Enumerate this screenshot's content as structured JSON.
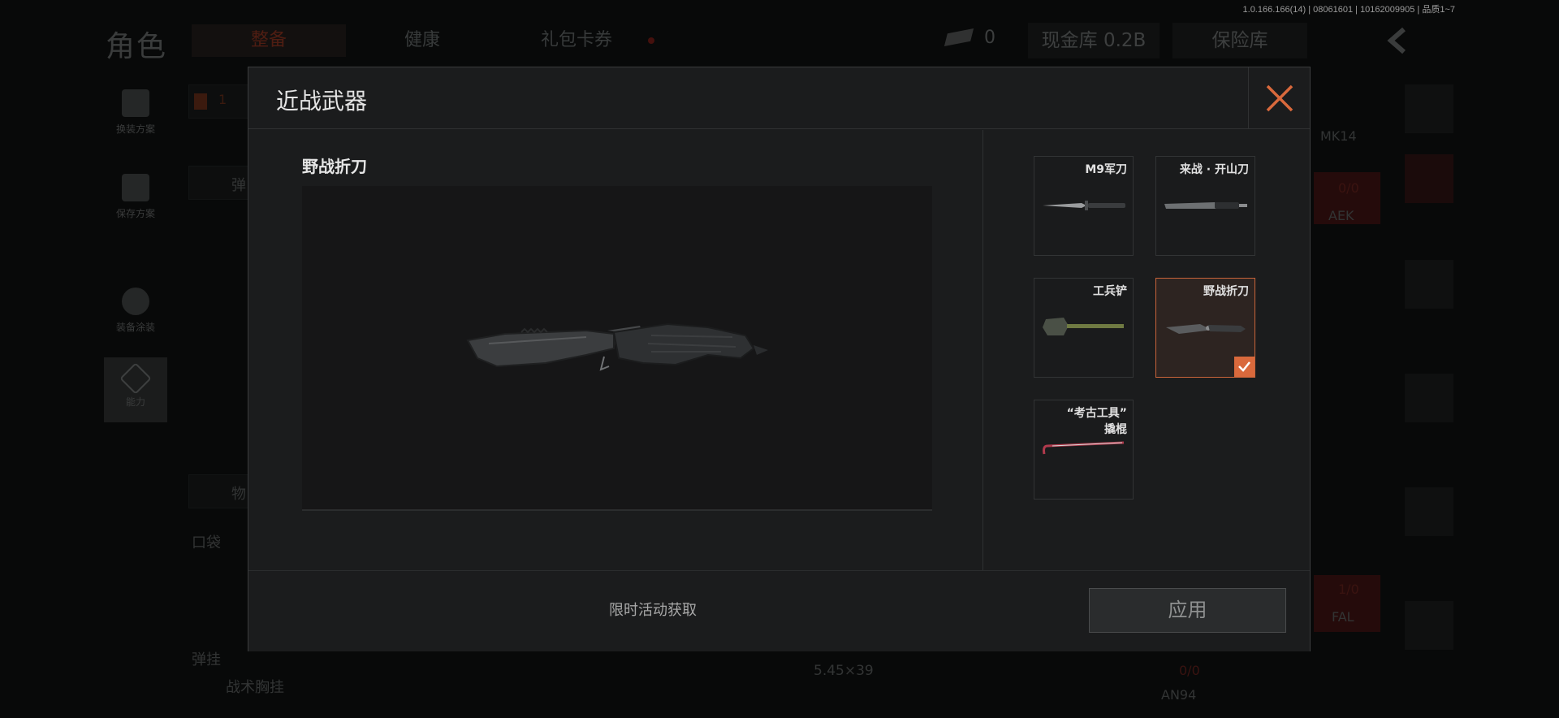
{
  "version_text": "1.0.166.166(14) | 08061601 | 10162009905 | 品质1~7",
  "background": {
    "page_title": "角色",
    "tabs": [
      "整备",
      "健康",
      "礼包卡券"
    ],
    "active_tab": "整备",
    "cash_count": "0",
    "cash_vault_label": "现金库 0.2B",
    "safe_label": "保险库",
    "side_buttons": [
      "换装方案",
      "保存方案",
      "装备涂装",
      "能力"
    ],
    "labels": {
      "ammo": "弹",
      "items": "物",
      "pocket": "口袋",
      "rig": "弹挂",
      "chest_rig": "战术胸挂",
      "mk14": "MK14",
      "aek": "AEK",
      "fal": "FAL",
      "an94": "AN94",
      "ammo_caliber": "5.45×39",
      "count_a": "0/0",
      "count_b": "1/0",
      "count_c": "0/0",
      "slot_number": "1"
    }
  },
  "modal": {
    "title": "近战武器",
    "selected_weapon": "野战折刀",
    "items": [
      {
        "label": "M9军刀",
        "icon": "bayonet-icon",
        "selected": false
      },
      {
        "label": "来战 · 开山刀",
        "icon": "machete-icon",
        "selected": false
      },
      {
        "label": "工兵铲",
        "icon": "shovel-icon",
        "selected": false
      },
      {
        "label": "野战折刀",
        "icon": "folding-knife-icon",
        "selected": true
      },
      {
        "label": "“考古工具”\n撬棍",
        "icon": "crowbar-icon",
        "selected": false
      }
    ],
    "acquire_text": "限时活动获取",
    "apply_label": "应用"
  },
  "colors": {
    "accent": "#d9693c",
    "modal_bg": "#1b1c1d",
    "apply_text": "#8f9191"
  }
}
